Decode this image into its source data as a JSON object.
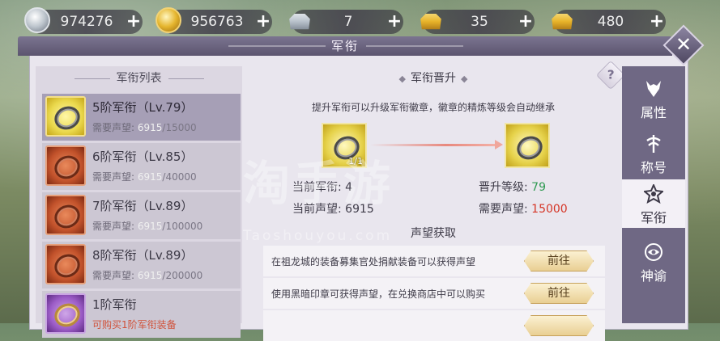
{
  "currencies": [
    {
      "icon": "silver-coin-icon",
      "value": "974276"
    },
    {
      "icon": "gold-coin-icon",
      "value": "956763"
    },
    {
      "icon": "silver-ingot-icon",
      "value": "7"
    },
    {
      "icon": "gold-ingot-icon",
      "value": "35"
    },
    {
      "icon": "gold-ingot-icon",
      "value": "480"
    }
  ],
  "window": {
    "title": "军衔"
  },
  "list": {
    "title": "军衔列表",
    "req_label": "需要声望:",
    "items": [
      {
        "name": "5阶军衔（Lv.79）",
        "current": "6915",
        "total": "/15000",
        "color": "gold"
      },
      {
        "name": "6阶军衔（Lv.85）",
        "current": "6915",
        "total": "/40000",
        "color": "red"
      },
      {
        "name": "7阶军衔（Lv.89）",
        "current": "6915",
        "total": "/100000",
        "color": "red"
      },
      {
        "name": "8阶军衔（Lv.89）",
        "current": "6915",
        "total": "/200000",
        "color": "red"
      },
      {
        "name": "1阶军衔",
        "note": "可购买1阶军衔装备",
        "color": "purple"
      }
    ]
  },
  "promote": {
    "title": "军衔晋升",
    "help": "?",
    "desc": "提升军衔可以升级军衔徽章，徽章的精炼等级会自动继承",
    "item_count": "1/1",
    "current_rank_label": "当前军衔:",
    "current_rank": "4",
    "current_rep_label": "当前声望:",
    "current_rep": "6915",
    "promote_level_label": "晋升等级:",
    "promote_level": "79",
    "need_rep_label": "需要声望:",
    "need_rep": "15000"
  },
  "reputation": {
    "title": "声望获取",
    "rows": [
      {
        "text": "在祖龙城的装备募集官处捐献装备可以获得声望",
        "button": "前往"
      },
      {
        "text": "使用黑暗印章可获得声望，在兑换商店中可以购买",
        "button": "前往"
      }
    ]
  },
  "tabs": [
    {
      "label": "属性",
      "icon": "wolf-head-icon",
      "active": false
    },
    {
      "label": "称号",
      "icon": "emblem-icon",
      "active": false
    },
    {
      "label": "军衔",
      "icon": "star-badge-icon",
      "active": true
    },
    {
      "label": "神谕",
      "icon": "eye-icon",
      "active": false
    }
  ],
  "watermark": {
    "main": "淘手游",
    "sub": "Taoshouyou.com"
  },
  "colors": {
    "accent_green": "#2f9a52",
    "accent_red": "#d53526",
    "panel": "#e9e6ee",
    "tab_bg": "#6f6884"
  }
}
